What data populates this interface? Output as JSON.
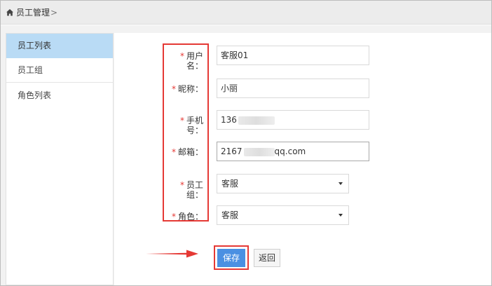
{
  "breadcrumb": {
    "home_icon": "home-icon",
    "label": "员工管理",
    "separator": ">"
  },
  "sidebar": {
    "items": [
      {
        "label": "员工列表",
        "active": true
      },
      {
        "label": "员工组",
        "active": false
      },
      {
        "label": "角色列表",
        "active": false
      }
    ]
  },
  "form": {
    "required_mark": "*",
    "username": {
      "label": "用户名：",
      "value": "客服01"
    },
    "nickname": {
      "label": "昵称：",
      "value": "小丽"
    },
    "phone": {
      "label": "手机号：",
      "value_visible": "136"
    },
    "email": {
      "label": "邮箱：",
      "value_prefix": "2167",
      "value_suffix": "qq.com"
    },
    "group": {
      "label": "员工组：",
      "selected": "客服"
    },
    "role": {
      "label": "角色：",
      "selected": "客服"
    }
  },
  "buttons": {
    "save": "保存",
    "back": "返回"
  },
  "colors": {
    "highlight": "#e53935",
    "primary": "#4a90e2",
    "sidebar_active": "#b9dbf5"
  }
}
